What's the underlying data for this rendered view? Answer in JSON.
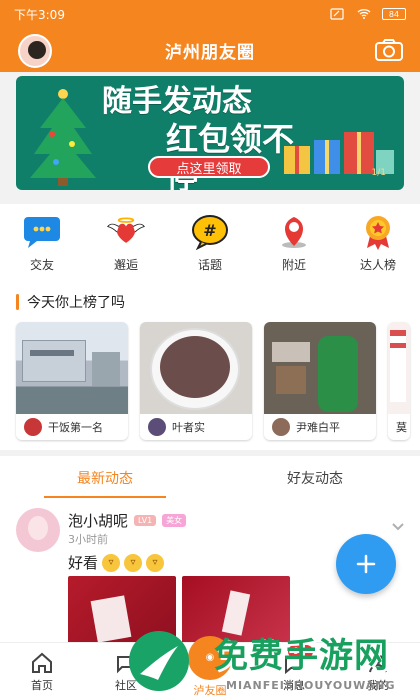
{
  "status_bar": {
    "time": "下午3:09",
    "battery": "84",
    "icons": [
      "sim-icon",
      "wifi-icon",
      "battery-icon"
    ]
  },
  "header": {
    "title": "泸州朋友圈",
    "icons": [
      "avatar",
      "camera-icon"
    ]
  },
  "banner": {
    "headline": "随手发动态",
    "subline": "红包领不停",
    "button": "点这里领取",
    "indicator": "1/1"
  },
  "quick_nav": [
    {
      "label": "交友",
      "icon": "chat-bubble-icon"
    },
    {
      "label": "邂逅",
      "icon": "heart-wings-icon"
    },
    {
      "label": "话题",
      "icon": "hashtag-icon"
    },
    {
      "label": "附近",
      "icon": "location-pin-icon"
    },
    {
      "label": "达人榜",
      "icon": "medal-icon"
    }
  ],
  "rank_section": {
    "title": "今天你上榜了吗",
    "cards": [
      {
        "user": "干饭第一名"
      },
      {
        "user": "叶者实"
      },
      {
        "user": "尹难白平"
      },
      {
        "user": "莫"
      }
    ]
  },
  "tabs": [
    {
      "label": "最新动态",
      "active": true
    },
    {
      "label": "好友动态",
      "active": false
    }
  ],
  "post": {
    "name": "泡小胡呢",
    "level": "LV1",
    "gender_badge": "美女",
    "time": "3小时前",
    "text": "好看"
  },
  "fab_icon": "plus-icon",
  "bottom_nav": [
    {
      "label": "首页",
      "icon": "home-icon"
    },
    {
      "label": "社区",
      "icon": "community-icon"
    },
    {
      "label": "泸友圈",
      "icon": "center-action-icon"
    },
    {
      "label": "消息",
      "icon": "message-icon"
    },
    {
      "label": "我的",
      "icon": "profile-icon"
    }
  ],
  "message_badge": "9+",
  "watermark": {
    "title": "免费手游网",
    "subtitle": "MIANFEISHOUYOUWANG"
  },
  "colors": {
    "brand": "#f5851f",
    "accent_blue": "#2f9cf2",
    "badge_red": "#e53935",
    "banner_green": "#0f7f6a"
  }
}
